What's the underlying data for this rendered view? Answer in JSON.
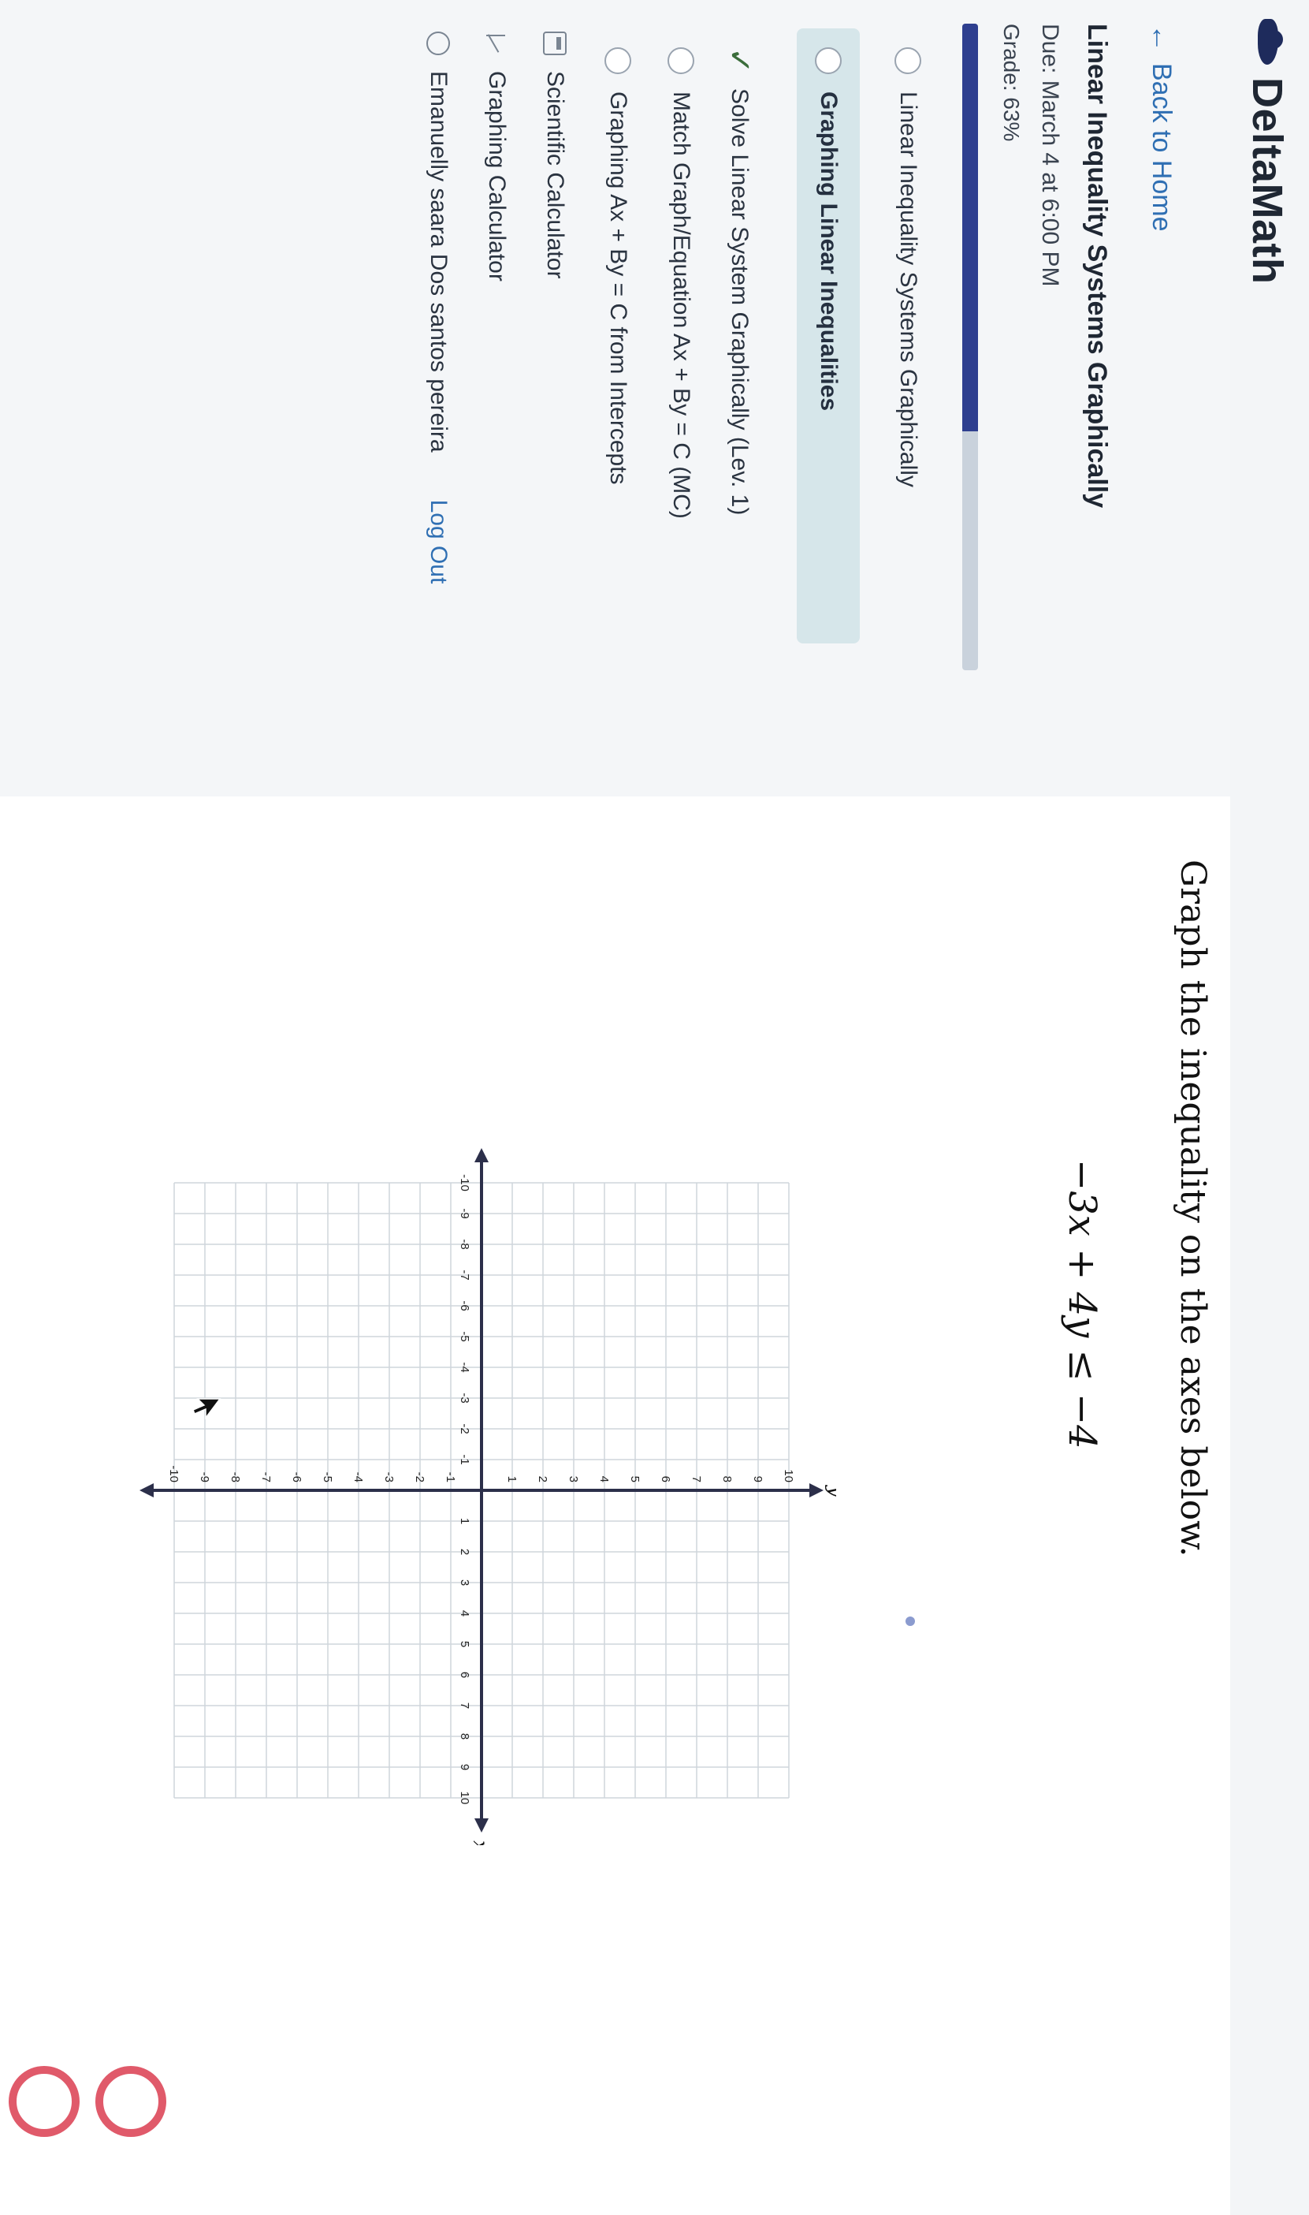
{
  "app": {
    "name": "DeltaMath"
  },
  "sidebar": {
    "back_label": "Back to Home",
    "assignment": {
      "title": "Linear Inequality Systems Graphically",
      "due": "Due: March 4 at 6:00 PM",
      "grade": "Grade: 63%",
      "progress_fraction": 0.63
    },
    "skills": [
      {
        "label": "Linear Inequality Systems Graphically",
        "status": "not-started"
      },
      {
        "label": "Graphing Linear Inequalities",
        "status": "current"
      },
      {
        "label": "Solve Linear System Graphically (Lev. 1)",
        "status": "complete"
      },
      {
        "label": "Match Graph/Equation Ax + By = C (MC)",
        "status": "not-started"
      },
      {
        "label": "Graphing Ax + By = C from Intercepts",
        "status": "not-started"
      }
    ],
    "tools": {
      "scientific_calculator": "Scientific Calculator",
      "graphing_calculator": "Graphing Calculator"
    },
    "user": {
      "name": "Emanuelly saara Dos santos pereira",
      "logout": "Log Out"
    }
  },
  "main": {
    "prompt": "Graph the inequality on the axes below.",
    "equation": "−3x + 4y ≤ −4"
  },
  "chart_data": {
    "type": "scatter",
    "title": "",
    "xlabel": "x",
    "ylabel": "y",
    "xlim": [
      -10,
      10
    ],
    "ylim": [
      -10,
      10
    ],
    "grid": true,
    "x_ticks": [
      -10,
      -9,
      -8,
      -7,
      -6,
      -5,
      -4,
      -3,
      -2,
      -1,
      1,
      2,
      3,
      4,
      5,
      6,
      7,
      8,
      9,
      10
    ],
    "y_ticks": [
      -10,
      -9,
      -8,
      -7,
      -6,
      -5,
      -4,
      -3,
      -2,
      -1,
      1,
      2,
      3,
      4,
      5,
      6,
      7,
      8,
      9,
      10
    ],
    "series": []
  },
  "colors": {
    "brand": "#1e2b5c",
    "link": "#2f6fb3",
    "progress": "#2e3f8f",
    "axis": "#2c2f4a",
    "grid": "#cfd6dc",
    "toolbar_red": "#e05a6a",
    "toolbar_teal": "#44b5c4"
  }
}
